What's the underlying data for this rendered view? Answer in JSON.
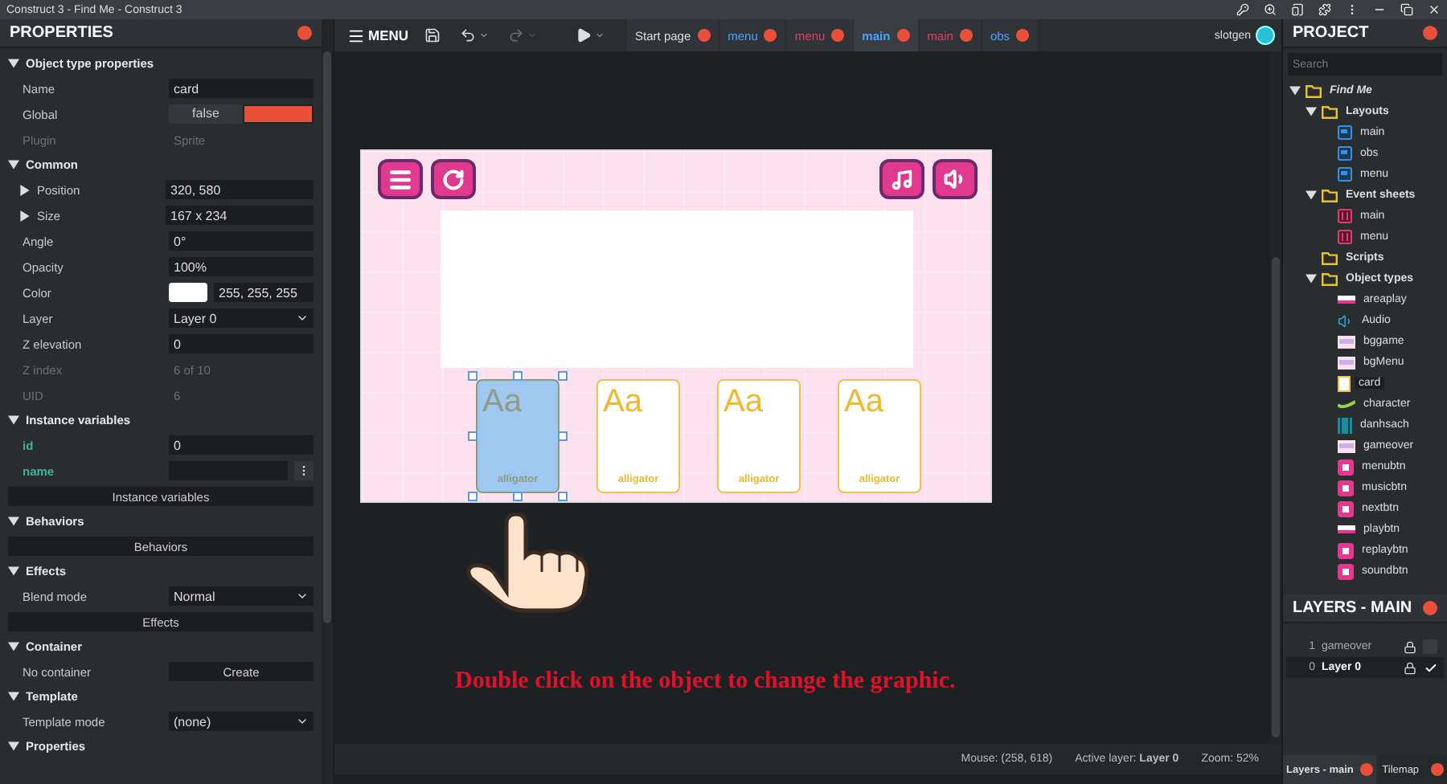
{
  "window": {
    "title": "Construct 3 - Find Me - Construct 3"
  },
  "properties": {
    "title": "PROPERTIES",
    "sections": [
      {
        "title": "Object type properties",
        "expanded": true,
        "rows": [
          {
            "kind": "text",
            "label": "Name",
            "value": "card"
          },
          {
            "kind": "toggle",
            "label": "Global",
            "value": "false",
            "on": false
          },
          {
            "kind": "readonly",
            "label": "Plugin",
            "value": "Sprite"
          }
        ]
      },
      {
        "title": "Common",
        "expanded": true,
        "rows": [
          {
            "kind": "group",
            "label": "Position",
            "value": "320, 580",
            "expanded": false
          },
          {
            "kind": "group",
            "label": "Size",
            "value": "167 x 234",
            "expanded": false
          },
          {
            "kind": "text",
            "label": "Angle",
            "value": "0°"
          },
          {
            "kind": "text",
            "label": "Opacity",
            "value": "100%"
          },
          {
            "kind": "color",
            "label": "Color",
            "value": "255, 255, 255"
          },
          {
            "kind": "select",
            "label": "Layer",
            "value": "Layer 0"
          },
          {
            "kind": "text",
            "label": "Z elevation",
            "value": "0"
          },
          {
            "kind": "readonly",
            "label": "Z index",
            "value": "6 of 10"
          },
          {
            "kind": "readonly",
            "label": "UID",
            "value": "6"
          }
        ]
      },
      {
        "title": "Instance variables",
        "expanded": true,
        "rows": [
          {
            "kind": "variable",
            "label": "id",
            "value": "0"
          },
          {
            "kind": "variable_menu",
            "label": "name"
          },
          {
            "kind": "button",
            "label": "Instance variables"
          }
        ]
      },
      {
        "title": "Behaviors",
        "expanded": true,
        "rows": [
          {
            "kind": "button",
            "label": "Behaviors"
          }
        ]
      },
      {
        "title": "Effects",
        "expanded": true,
        "rows": [
          {
            "kind": "select",
            "label": "Blend mode",
            "value": "Normal"
          },
          {
            "kind": "button",
            "label": "Effects"
          }
        ]
      },
      {
        "title": "Container",
        "expanded": true,
        "rows": [
          {
            "kind": "action",
            "label": "No container",
            "value": "Create"
          }
        ]
      },
      {
        "title": "Template",
        "expanded": true,
        "rows": [
          {
            "kind": "select",
            "label": "Template mode",
            "value": "(none)"
          }
        ]
      },
      {
        "title": "Properties",
        "expanded": true
      }
    ]
  },
  "toolbar": {
    "menu_label": "MENU",
    "user": "slotgen",
    "tabs": [
      {
        "label": "Start page",
        "kind": "page",
        "selected": false
      },
      {
        "label": "menu",
        "kind": "layout",
        "selected": false
      },
      {
        "label": "menu",
        "kind": "eventsheet",
        "selected": false
      },
      {
        "label": "main",
        "kind": "layout",
        "selected": true
      },
      {
        "label": "main",
        "kind": "eventsheet",
        "selected": false
      },
      {
        "label": "obs",
        "kind": "layout",
        "selected": false
      }
    ]
  },
  "layout_view": {
    "buttons": [
      {
        "kind": "menu"
      },
      {
        "kind": "replay"
      },
      {
        "kind": "music"
      },
      {
        "kind": "sound"
      }
    ],
    "cards": [
      {
        "glyph": "Aa",
        "word": "alligator",
        "selected": true
      },
      {
        "glyph": "Aa",
        "word": "alligator",
        "selected": false
      },
      {
        "glyph": "Aa",
        "word": "alligator",
        "selected": false
      },
      {
        "glyph": "Aa",
        "word": "alligator",
        "selected": false
      }
    ]
  },
  "instruction": "Double click on the object to change the graphic.",
  "status_bar": {
    "mouse": "Mouse: (258, 618)",
    "active_layer": "Active layer: **Layer 0**",
    "zoom": "Zoom: 52%"
  },
  "project": {
    "title": "PROJECT",
    "search": {
      "placeholder": "Search"
    },
    "tree": [
      {
        "label": "Find Me",
        "kind": "folder",
        "expanded": true,
        "selected": false,
        "children": [
          {
            "label": "Layouts",
            "kind": "folder",
            "expanded": true,
            "selected": false,
            "children": [
              {
                "label": "main",
                "kind": "layout",
                "selected": false
              },
              {
                "label": "obs",
                "kind": "layout",
                "selected": false
              },
              {
                "label": "menu",
                "kind": "layout",
                "selected": false
              }
            ]
          },
          {
            "label": "Event sheets",
            "kind": "folder",
            "expanded": true,
            "selected": false,
            "children": [
              {
                "label": "main",
                "kind": "eventsheet",
                "selected": false
              },
              {
                "label": "menu",
                "kind": "eventsheet",
                "selected": false
              }
            ]
          },
          {
            "label": "Scripts",
            "kind": "folder",
            "selected": false
          },
          {
            "label": "Object types",
            "kind": "folder",
            "expanded": true,
            "selected": false,
            "children": [
              {
                "label": "areaplay",
                "kind": "bar",
                "selected": false
              },
              {
                "label": "Audio",
                "kind": "audio",
                "selected": false
              },
              {
                "label": "bggame",
                "kind": "image",
                "selected": false
              },
              {
                "label": "bgMenu",
                "kind": "image",
                "selected": false
              },
              {
                "label": "card",
                "kind": "card",
                "selected": true
              },
              {
                "label": "character",
                "kind": "tick",
                "selected": false
              },
              {
                "label": "danhsach",
                "kind": "list",
                "selected": false
              },
              {
                "label": "gameover",
                "kind": "image",
                "selected": false
              },
              {
                "label": "menubtn",
                "kind": "button",
                "selected": false
              },
              {
                "label": "musicbtn",
                "kind": "button",
                "selected": false
              },
              {
                "label": "nextbtn",
                "kind": "button",
                "selected": false
              },
              {
                "label": "playbtn",
                "kind": "bar",
                "selected": false
              },
              {
                "label": "replaybtn",
                "kind": "button",
                "selected": false
              },
              {
                "label": "soundbtn",
                "kind": "button",
                "selected": false
              }
            ]
          }
        ]
      }
    ]
  },
  "layers": {
    "title": "LAYERS - MAIN",
    "rows": [
      {
        "index": "1",
        "name": "gameover",
        "visible": false,
        "selected": false
      },
      {
        "index": "0",
        "name": "Layer 0",
        "visible": true,
        "selected": true
      }
    ]
  },
  "bottom_tabs": [
    {
      "label": "Layers - main",
      "selected": true
    },
    {
      "label": "Tilemap",
      "selected": false
    }
  ]
}
